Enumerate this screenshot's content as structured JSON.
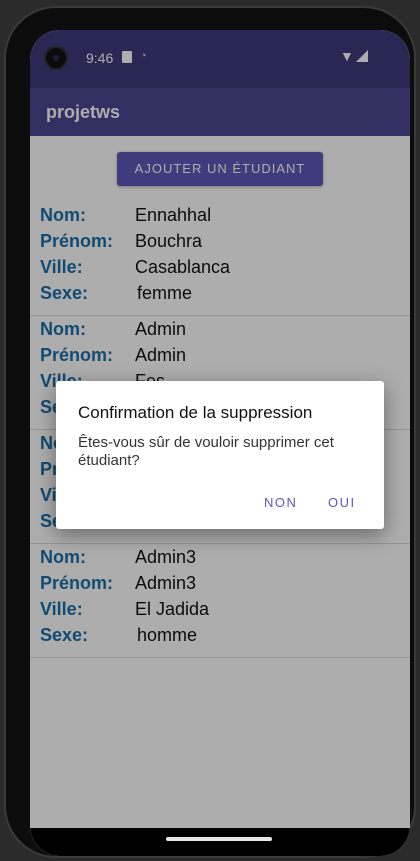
{
  "status": {
    "time": "9:46"
  },
  "app": {
    "title": "projetws"
  },
  "add_button": "AJOUTER UN ÉTUDIANT",
  "labels": {
    "nom": "Nom:",
    "prenom": "Prénom:",
    "ville": "Ville:",
    "sexe": "Sexe:"
  },
  "students": [
    {
      "nom": "Ennahhal",
      "prenom": "Bouchra",
      "ville": "Casablanca",
      "sexe": "femme"
    },
    {
      "nom": "Admin",
      "prenom": "Admin",
      "ville": "Fes",
      "sexe": ""
    },
    {
      "nom": "",
      "prenom": "",
      "ville": "",
      "sexe": ""
    },
    {
      "nom": "Admin3",
      "prenom": "Admin3",
      "ville": "El Jadida",
      "sexe": "homme"
    }
  ],
  "dialog": {
    "title": "Confirmation de la suppression",
    "message": "Êtes-vous sûr de vouloir supprimer cet étudiant?",
    "negative": "NON",
    "positive": "OUI"
  },
  "colors": {
    "appbar": "#4a4691",
    "accent": "#5e59b8",
    "label": "#1b6fa8"
  }
}
